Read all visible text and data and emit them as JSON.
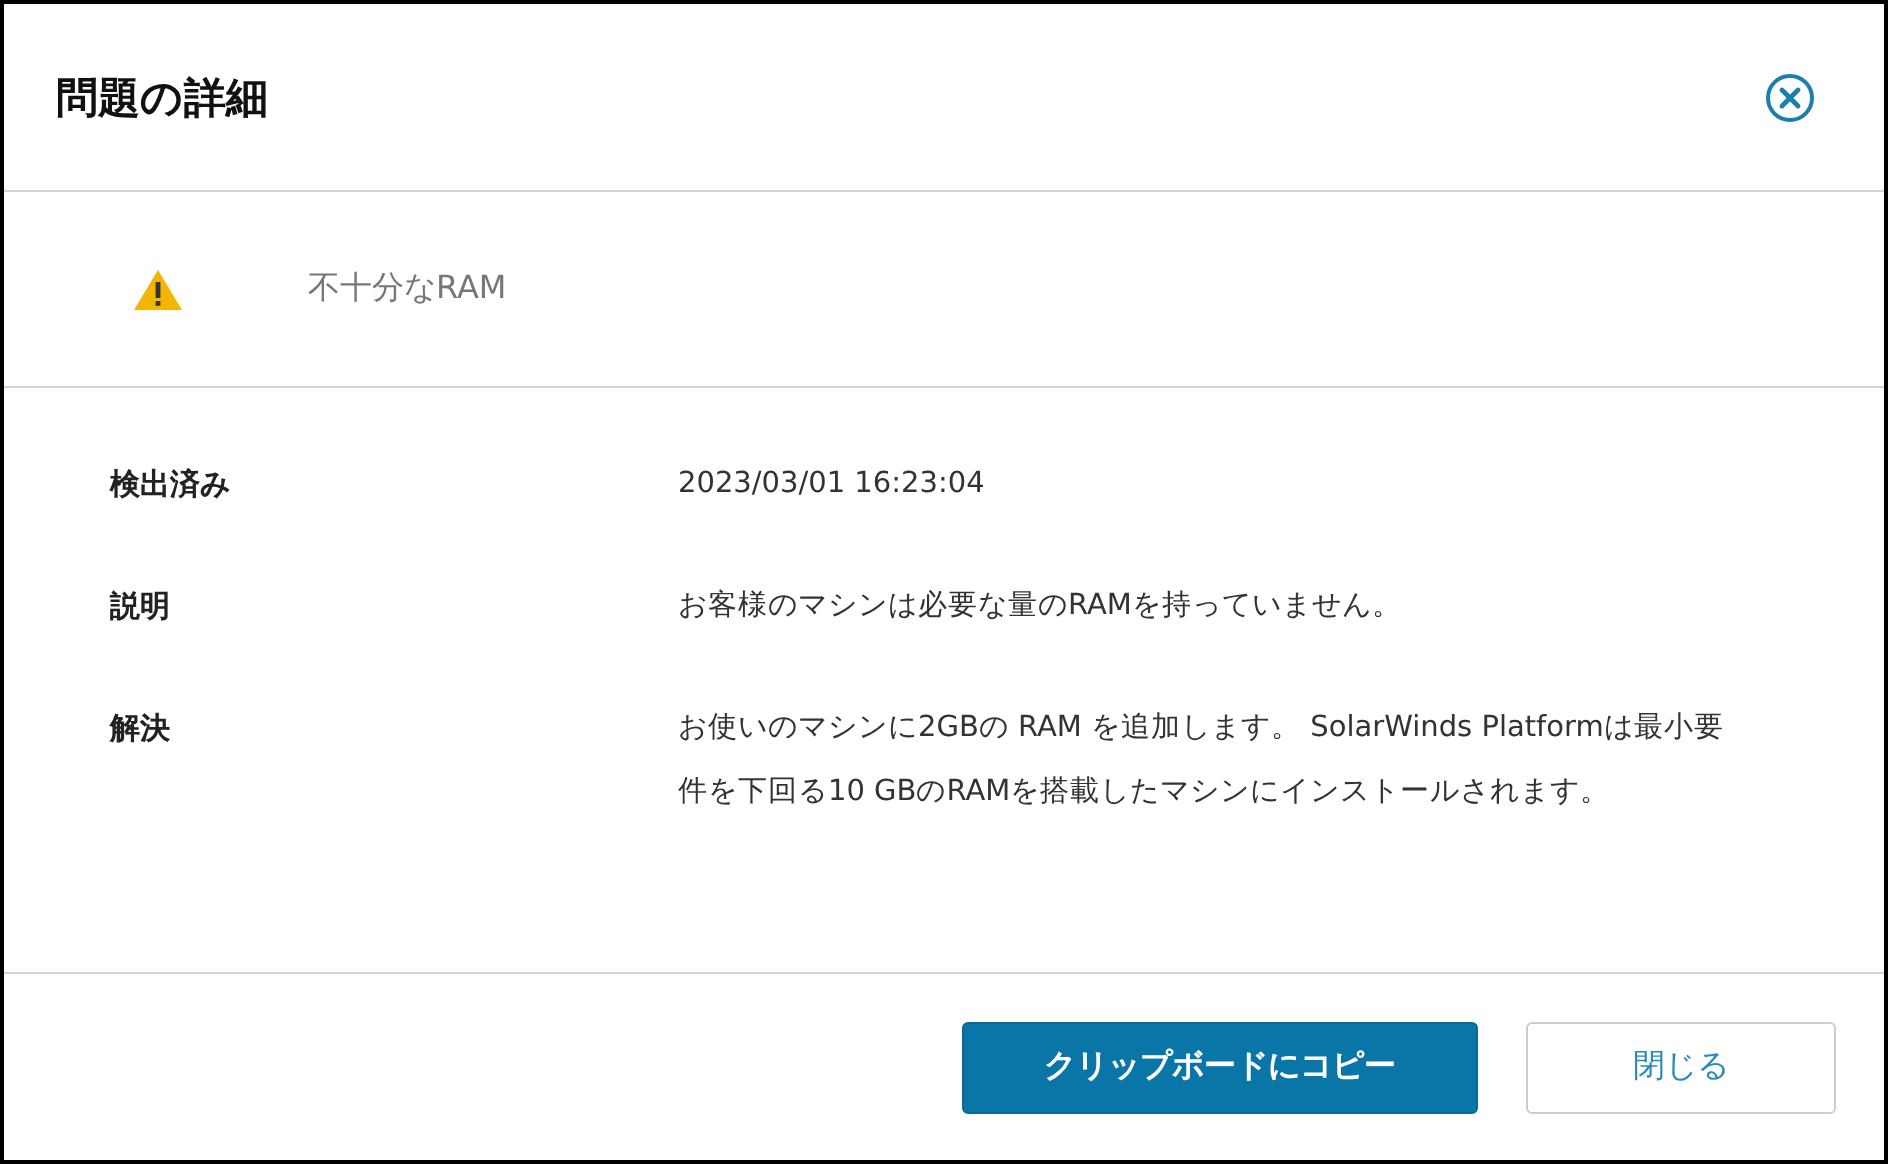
{
  "dialog": {
    "title": "問題の詳細",
    "issue": {
      "kind": "warning",
      "text": "不十分なRAM"
    },
    "details": [
      {
        "label": "検出済み",
        "value": "2023/03/01 16:23:04"
      },
      {
        "label": "説明",
        "value": "お客様のマシンは必要な量のRAMを持っていません。"
      },
      {
        "label": "解決",
        "value": "お使いのマシンに2GBの RAM を追加します。 SolarWinds Platformは最小要件を下回る10 GBのRAMを搭載したマシンにインストールされます。"
      }
    ],
    "buttons": [
      {
        "label": "クリップボードにコピー",
        "kind": "primary"
      },
      {
        "label": "閉じる",
        "kind": "secondary"
      }
    ]
  }
}
